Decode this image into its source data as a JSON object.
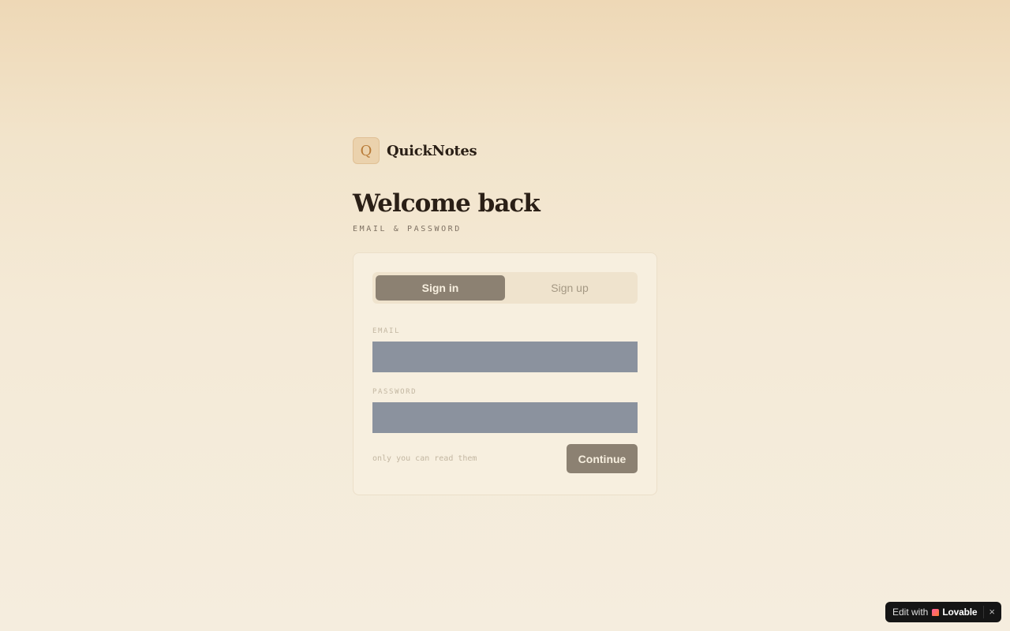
{
  "brand": {
    "mark": "Q",
    "name": "QuickNotes"
  },
  "heading": {
    "title": "Welcome back",
    "subtitle": "EMAIL & PASSWORD"
  },
  "tabs": [
    {
      "label": "Sign in",
      "active": true
    },
    {
      "label": "Sign up",
      "active": false
    }
  ],
  "form": {
    "email_label": "EMAIL",
    "email_value": "",
    "password_label": "PASSWORD",
    "password_value": "",
    "hint": "only you can read them",
    "submit_label": "Continue"
  },
  "badge": {
    "prefix": "Edit with",
    "brand": "Lovable",
    "close_icon": "close-icon"
  },
  "colors": {
    "accent": "#8c8172",
    "field": "#8b929e",
    "brand_mark": "#ebd2ad",
    "card": "#f7efdf"
  }
}
